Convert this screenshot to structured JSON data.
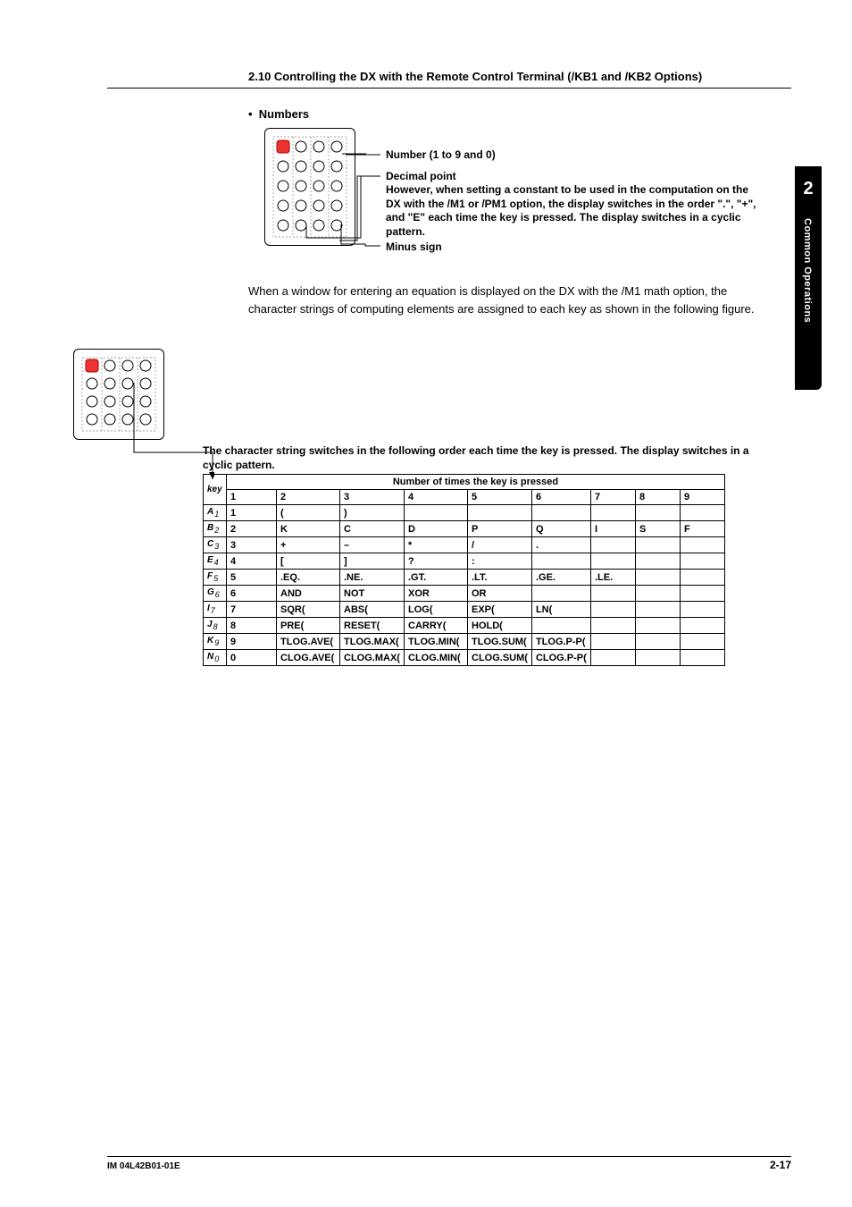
{
  "header": {
    "section_title": "2.10  Controlling the DX with the Remote Control Terminal (/KB1 and /KB2 Options)"
  },
  "sidetab": {
    "number": "2",
    "label": "Common Operations"
  },
  "bullet": {
    "text": "Numbers",
    "marker": "•"
  },
  "annotations": {
    "number": "Number (1 to 9 and 0)",
    "decimal_point": "Decimal point",
    "decimal_detail": "However, when setting a constant to be used in the computation on the DX with the /M1 or /PM1 option, the display switches in the order \".\", \"+\", and \"E\" each time the key is pressed. The display switches in a cyclic pattern.",
    "minus": "Minus sign"
  },
  "paragraph": "When a window for entering an equation is displayed on the DX with the /M1 math option, the character strings of computing elements are assigned to each key as shown in the following figure.",
  "table_caption": "The character string switches in the following order each time the key is pressed.  The display switches in a cyclic pattern.",
  "table": {
    "head": {
      "key": "key",
      "span": "Number of times the key is pressed"
    },
    "cols": [
      "1",
      "2",
      "3",
      "4",
      "5",
      "6",
      "7",
      "8",
      "9"
    ],
    "rows": [
      {
        "key": "A",
        "sym": "1",
        "cells": [
          "1",
          "(",
          ")",
          "",
          "",
          "",
          "",
          "",
          ""
        ]
      },
      {
        "key": "B",
        "sym": "2",
        "cells": [
          "2",
          "K",
          "C",
          "D",
          "P",
          "Q",
          "I",
          "S",
          "F"
        ]
      },
      {
        "key": "C",
        "sym": "3",
        "cells": [
          "3",
          "+",
          "–",
          "*",
          "/",
          ".",
          "",
          "",
          ""
        ]
      },
      {
        "key": "E",
        "sym": "4",
        "cells": [
          "4",
          "[",
          "]",
          "?",
          ":",
          "",
          "",
          "",
          ""
        ]
      },
      {
        "key": "F",
        "sym": "5",
        "cells": [
          "5",
          ".EQ.",
          ".NE.",
          ".GT.",
          ".LT.",
          ".GE.",
          ".LE.",
          "",
          ""
        ]
      },
      {
        "key": "G",
        "sym": "6",
        "cells": [
          "6",
          "AND",
          "NOT",
          "XOR",
          "OR",
          "",
          "",
          "",
          ""
        ]
      },
      {
        "key": "I",
        "sym": "7",
        "cells": [
          "7",
          "SQR(",
          "ABS(",
          "LOG(",
          "EXP(",
          "LN(",
          "",
          "",
          ""
        ]
      },
      {
        "key": "J",
        "sym": "8",
        "cells": [
          "8",
          "PRE(",
          "RESET(",
          "CARRY(",
          "HOLD(",
          "",
          "",
          "",
          ""
        ]
      },
      {
        "key": "K",
        "sym": "9",
        "cells": [
          "9",
          "TLOG.AVE(",
          "TLOG.MAX(",
          "TLOG.MIN(",
          "TLOG.SUM(",
          "TLOG.P-P(",
          "",
          "",
          ""
        ]
      },
      {
        "key": "N",
        "sym": "0",
        "cells": [
          "0",
          "CLOG.AVE(",
          "CLOG.MAX(",
          "CLOG.MIN(",
          "CLOG.SUM(",
          "CLOG.P-P(",
          "",
          "",
          ""
        ]
      }
    ]
  },
  "footer": {
    "left": "IM 04L42B01-01E",
    "right": "2-17"
  }
}
